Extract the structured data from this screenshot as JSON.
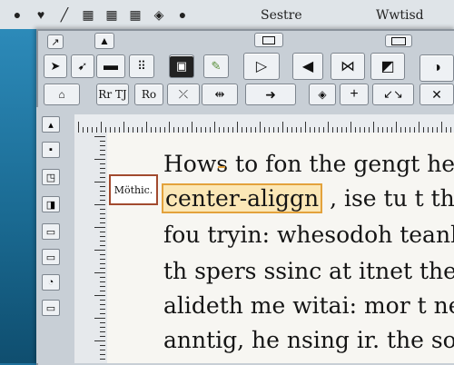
{
  "menubar": {
    "icons": [
      "record-icon",
      "heart-icon",
      "pen-icon",
      "grid-icon",
      "grid-icon",
      "grid-icon",
      "shield-icon",
      "record-icon"
    ],
    "left_text": "Sestre",
    "right_text": "Wwtisd"
  },
  "toolbar1": {
    "btn_rr_label": "Rr TJ",
    "btn_ro_label": "Ro"
  },
  "document": {
    "side_tag": "Möthic.",
    "lines": [
      "Hows to fon the gengt he mgatt",
      "center-aliggn",
      " , ise tu t the lsen f",
      "fou tryin: whesodoh teank you",
      "th spers ssinc at itnet the rient is",
      "alideth me witai: mor t ne left tre",
      "anntig, he nsing ir. the sothera"
    ]
  },
  "colors": {
    "desktop": "#1f6f9a",
    "chrome": "#c8cfd6",
    "page": "#f7f6f2",
    "highlight": "#e3a23c"
  }
}
